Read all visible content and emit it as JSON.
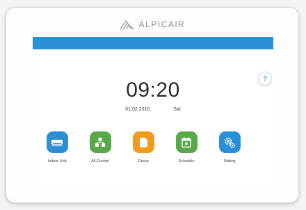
{
  "brand": {
    "name": "ALPICAIR"
  },
  "screen": {
    "accent_color": "#2b8fd6",
    "help_label": "?",
    "time": "09:20",
    "date": "01.02.2016",
    "weekday": "Sat"
  },
  "menu": {
    "items": [
      {
        "label": "Indoor Unit",
        "icon": "indoor-unit-icon",
        "color": "#2b8fd6"
      },
      {
        "label": "All-Control",
        "icon": "all-control-icon",
        "color": "#5ba84a"
      },
      {
        "label": "Group",
        "icon": "group-folder-icon",
        "color": "#f09a1e"
      },
      {
        "label": "Schedule",
        "icon": "calendar-icon",
        "color": "#5ba84a"
      },
      {
        "label": "Setting",
        "icon": "settings-gear-icon",
        "color": "#2b8fd6"
      }
    ]
  }
}
